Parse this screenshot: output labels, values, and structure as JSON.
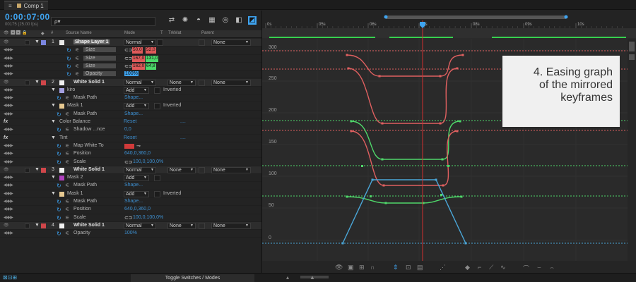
{
  "tab": {
    "label": "Comp 1",
    "close": "≡"
  },
  "timecode": "0:00:07:00",
  "fps_info": "00175 (25.00 fps)",
  "search": {
    "placeholder": "",
    "icon": "ρ▾"
  },
  "columns": {
    "source_name": "Source Name",
    "mode": "Mode",
    "t": "T",
    "trkmat": "TrkMat",
    "parent": "Parent",
    "hash": "#"
  },
  "rows": [
    {
      "type": "layer",
      "num": "1",
      "label": "Shape Layer 1",
      "color": "#7b86e0",
      "mode": "Normal",
      "parent": "None"
    },
    {
      "type": "prop",
      "label": "Size",
      "v1": "50,0",
      "v2": "52,0",
      "c1": "#e05a5a",
      "c2": "#e05a5a"
    },
    {
      "type": "prop",
      "label": "Size",
      "v1": "167,0",
      "v2": "131,0",
      "c1": "#e05a5a",
      "c2": "#4cd86a"
    },
    {
      "type": "prop",
      "label": "Size",
      "v1": "162,0",
      "v2": "64,8",
      "c1": "#e05a5a",
      "c2": "#4cd86a"
    },
    {
      "type": "prop",
      "label": "Opacity",
      "value": "100%"
    },
    {
      "type": "layer",
      "num": "2",
      "label": "White Solid 1",
      "color": "#d0464a",
      "mode": "Normal",
      "trkmat": "None",
      "parent": "None"
    },
    {
      "type": "mask",
      "label": "kiro",
      "color": "#a4a0e0",
      "mode": "Add",
      "inverted": "Inverted"
    },
    {
      "type": "prop",
      "label": "Mask Path",
      "value": "Shape..."
    },
    {
      "type": "mask",
      "label": "Mask 1",
      "color": "#e6c890",
      "mode": "Add",
      "inverted": "Inverted"
    },
    {
      "type": "prop",
      "label": "Mask Path",
      "value": "Shape..."
    },
    {
      "type": "fx",
      "label": "Color Balance",
      "value": "Reset",
      "extra": "...."
    },
    {
      "type": "prop",
      "label": "Shadow ...nce",
      "value": "0,0"
    },
    {
      "type": "fx",
      "label": "Tint",
      "value": "Reset",
      "extra": "...."
    },
    {
      "type": "prop",
      "label": "Map White To",
      "value": ""
    },
    {
      "type": "prop",
      "label": "Position",
      "value": "640,0,360,0"
    },
    {
      "type": "prop",
      "label": "Scale",
      "value": "100,0,100,0%"
    },
    {
      "type": "layer",
      "num": "3",
      "label": "White Solid 1",
      "color": "#d0464a",
      "mode": "Normal",
      "trkmat": "None",
      "parent": "None"
    },
    {
      "type": "mask",
      "label": "Mask 2",
      "color": "#b040c0",
      "mode": "Add",
      "inverted": ""
    },
    {
      "type": "prop",
      "label": "Mask Path",
      "value": "Shape..."
    },
    {
      "type": "mask",
      "label": "Mask 1",
      "color": "#e6c890",
      "mode": "Add",
      "inverted": "Inverted"
    },
    {
      "type": "prop",
      "label": "Mask Path",
      "value": "Shape..."
    },
    {
      "type": "prop",
      "label": "Position",
      "value": "640,0,360,0"
    },
    {
      "type": "prop",
      "label": "Scale",
      "value": "100,0,100,0%"
    },
    {
      "type": "layer",
      "num": "4",
      "label": "White Solid 1",
      "color": "#d0464a",
      "mode": "Normal",
      "trkmat": "None",
      "parent": "None"
    },
    {
      "type": "prop",
      "label": "Opacity",
      "value": "100%"
    }
  ],
  "ruler": [
    "0s",
    "05s",
    "06s",
    "07s",
    "08s",
    "09s",
    "10s"
  ],
  "yaxis": [
    "300",
    "250",
    "200",
    "150",
    "100",
    "50",
    "0"
  ],
  "annotation": [
    "4. Easing graph",
    "of the mirrored",
    "keyframes"
  ],
  "bottom": {
    "toggle": "Toggle Switches / Modes"
  },
  "colors": {
    "red": "#e06060",
    "green": "#4fd86a",
    "blue": "#4aa6d8",
    "playhead": "#d03030",
    "accent": "#3fa4f0"
  }
}
